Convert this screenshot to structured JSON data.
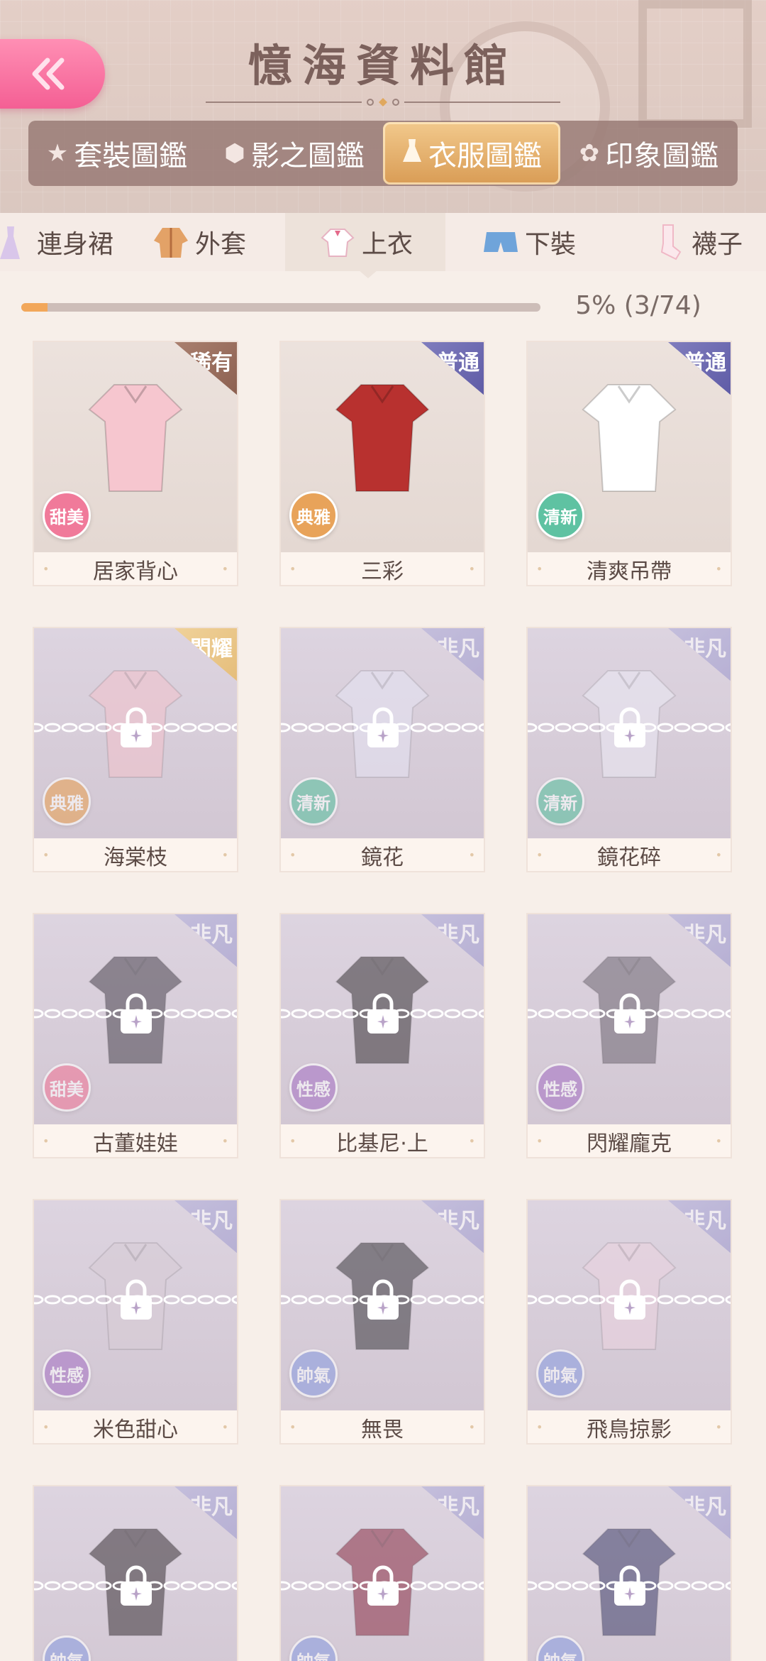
{
  "header": {
    "title": "憶海資料館",
    "back_icon": "double-chevron-left-icon",
    "main_tabs": [
      {
        "label": "套裝圖鑑",
        "icon": "star-icon",
        "active": false
      },
      {
        "label": "影之圖鑑",
        "icon": "hexagon-icon",
        "active": false
      },
      {
        "label": "衣服圖鑑",
        "icon": "dress-icon",
        "active": true
      },
      {
        "label": "印象圖鑑",
        "icon": "flower-icon",
        "active": false
      }
    ]
  },
  "sub_tabs": [
    {
      "label": "連身裙",
      "icon": "dress-icon",
      "active": false
    },
    {
      "label": "外套",
      "icon": "jacket-icon",
      "active": false
    },
    {
      "label": "上衣",
      "icon": "shirt-icon",
      "active": true
    },
    {
      "label": "下裝",
      "icon": "shorts-icon",
      "active": false
    },
    {
      "label": "襪子",
      "icon": "sock-icon",
      "active": false
    }
  ],
  "progress": {
    "text": "5% (3/74)",
    "fraction": 0.05
  },
  "colors": {
    "accent_pink": "#f45f94",
    "tab_active": "#e2aa66",
    "badge_sweet": "#f07a9a",
    "badge_elegant": "#e8a35a",
    "badge_fresh": "#5fc2a2",
    "badge_sexy": "#a978c6",
    "badge_cool": "#8f9fe0"
  },
  "items": [
    {
      "name": "居家背心",
      "rarity": "稀有",
      "rarity_class": "rare",
      "style": "甜美",
      "style_color": "#f07a9a",
      "locked": false,
      "cloth_color": "#f6c6cf"
    },
    {
      "name": "三彩",
      "rarity": "普通",
      "rarity_class": "normal",
      "style": "典雅",
      "style_color": "#e8a35a",
      "locked": false,
      "cloth_color": "#b8312f"
    },
    {
      "name": "清爽吊帶",
      "rarity": "普通",
      "rarity_class": "normal",
      "style": "清新",
      "style_color": "#5fc2a2",
      "locked": false,
      "cloth_color": "#ffffff"
    },
    {
      "name": "海棠枝",
      "rarity": "閃耀",
      "rarity_class": "shiny",
      "style": "典雅",
      "style_color": "#e8a35a",
      "locked": true,
      "cloth_color": "#f3c2cc"
    },
    {
      "name": "鏡花",
      "rarity": "非凡",
      "rarity_class": "extra",
      "style": "清新",
      "style_color": "#5fc2a2",
      "locked": true,
      "cloth_color": "#e6e4f4"
    },
    {
      "name": "鏡花碎",
      "rarity": "非凡",
      "rarity_class": "extra",
      "style": "清新",
      "style_color": "#5fc2a2",
      "locked": true,
      "cloth_color": "#eceaf5"
    },
    {
      "name": "古董娃娃",
      "rarity": "非凡",
      "rarity_class": "extra",
      "style": "甜美",
      "style_color": "#f07a9a",
      "locked": true,
      "cloth_color": "#4b4550"
    },
    {
      "name": "比基尼·上",
      "rarity": "非凡",
      "rarity_class": "extra",
      "style": "性感",
      "style_color": "#a978c6",
      "locked": true,
      "cloth_color": "#3a3538"
    },
    {
      "name": "閃耀龐克",
      "rarity": "非凡",
      "rarity_class": "extra",
      "style": "性感",
      "style_color": "#a978c6",
      "locked": true,
      "cloth_color": "#6e6772"
    },
    {
      "name": "米色甜心",
      "rarity": "非凡",
      "rarity_class": "extra",
      "style": "性感",
      "style_color": "#a978c6",
      "locked": true,
      "cloth_color": "#d8ccd6"
    },
    {
      "name": "無畏",
      "rarity": "非凡",
      "rarity_class": "extra",
      "style": "帥氣",
      "style_color": "#8f9fe0",
      "locked": true,
      "cloth_color": "#3c3a3f"
    },
    {
      "name": "飛鳥掠影",
      "rarity": "非凡",
      "rarity_class": "extra",
      "style": "帥氣",
      "style_color": "#8f9fe0",
      "locked": true,
      "cloth_color": "#ecd3e0"
    },
    {
      "name": "",
      "rarity": "非凡",
      "rarity_class": "extra",
      "style": "帥氣",
      "style_color": "#8f9fe0",
      "locked": true,
      "cloth_color": "#3b3338"
    },
    {
      "name": "",
      "rarity": "非凡",
      "rarity_class": "extra",
      "style": "帥氣",
      "style_color": "#8f9fe0",
      "locked": true,
      "cloth_color": "#8a2f45"
    },
    {
      "name": "",
      "rarity": "非凡",
      "rarity_class": "extra",
      "style": "帥氣",
      "style_color": "#8f9fe0",
      "locked": true,
      "cloth_color": "#3f3f6a"
    }
  ]
}
